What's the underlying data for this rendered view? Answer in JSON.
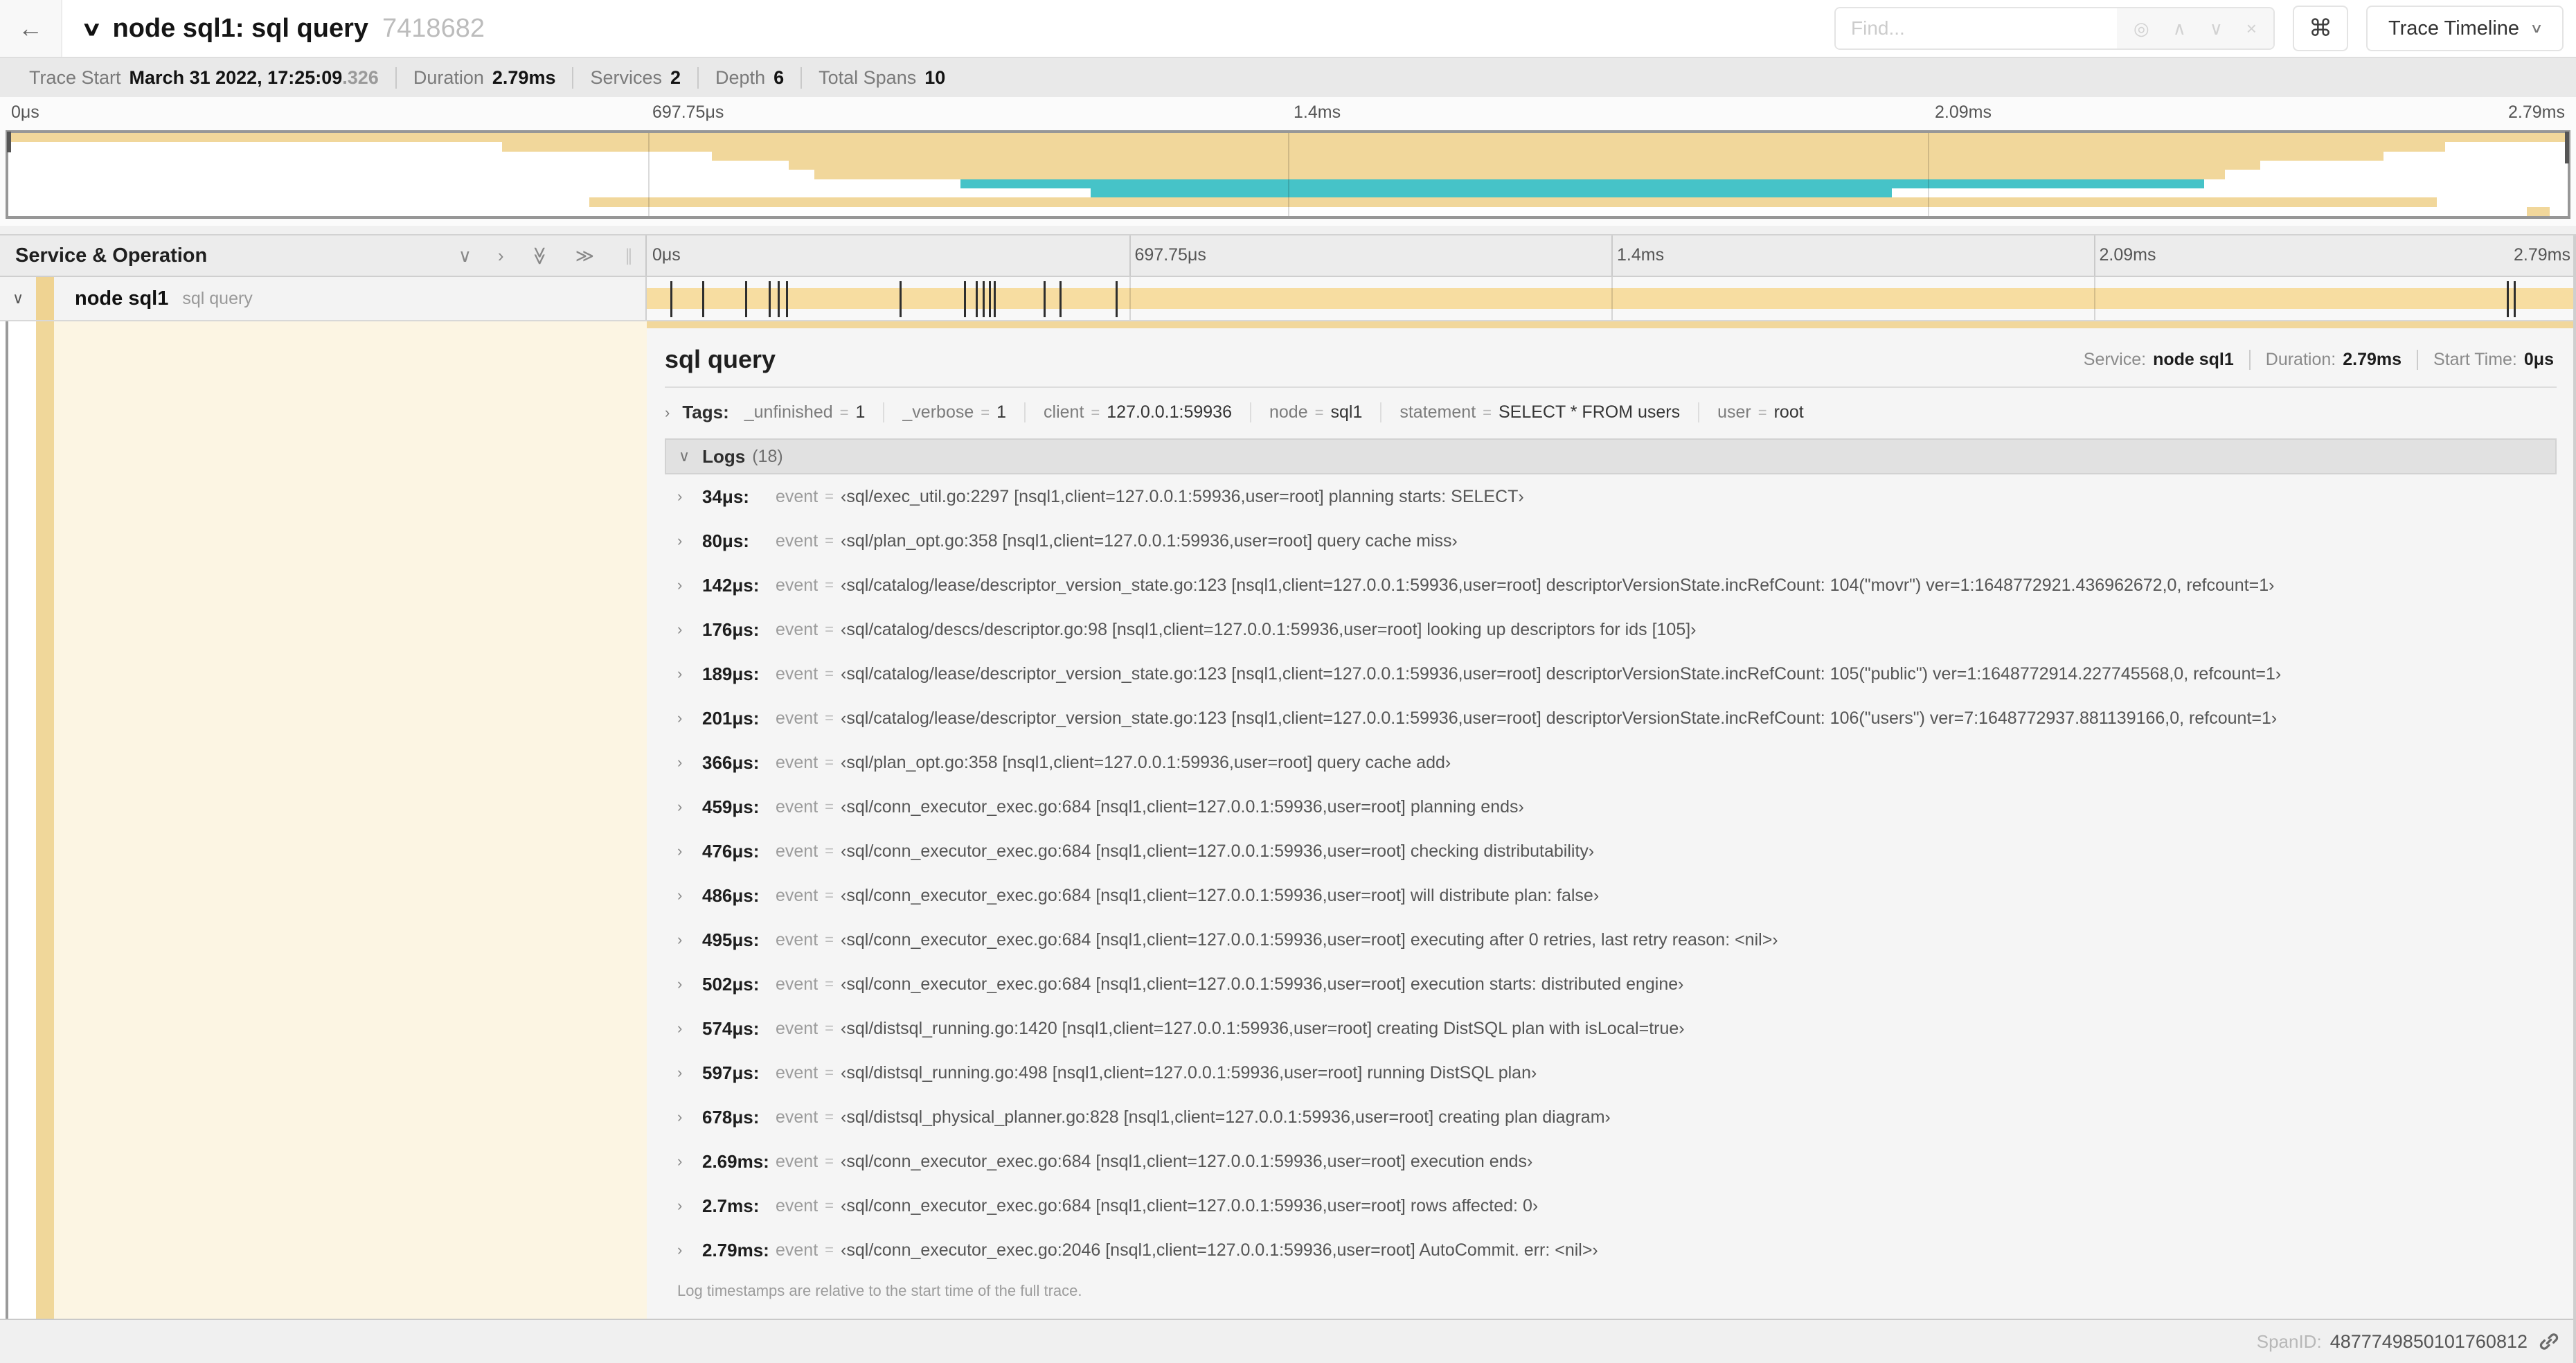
{
  "icons": {
    "back": "←",
    "collapse_down": "∨",
    "chevron_right": "›",
    "double_right": "≫",
    "drag_handle": "∥",
    "caret_down": "∨",
    "find_target": "◎",
    "find_up": "∧",
    "find_down": "∨",
    "find_close": "×",
    "command": "⌘"
  },
  "misc": {
    "eq": "="
  },
  "header": {
    "title": "node sql1: sql query",
    "trace_id": "7418682",
    "find_placeholder": "Find...",
    "view_selector": "Trace Timeline"
  },
  "summary": {
    "items": [
      {
        "label": "Trace Start",
        "value": "March 31 2022, 17:25:09",
        "suffix": ".326"
      },
      {
        "label": "Duration",
        "value": "2.79ms",
        "suffix": ""
      },
      {
        "label": "Services",
        "value": "2",
        "suffix": ""
      },
      {
        "label": "Depth",
        "value": "6",
        "suffix": ""
      },
      {
        "label": "Total Spans",
        "value": "10",
        "suffix": ""
      }
    ]
  },
  "timeline": {
    "tick_labels": [
      "0μs",
      "697.75μs",
      "1.4ms",
      "2.09ms",
      "2.79ms"
    ],
    "tick_positions": [
      0,
      25,
      50,
      75,
      100
    ]
  },
  "left_panel": {
    "header_title": "Service & Operation",
    "row": {
      "service": "node sql1",
      "operation": "sql query"
    }
  },
  "chart_data": {
    "type": "gantt-minimap",
    "total_us": 2790,
    "span_colors": {
      "sql": "#f1d79b",
      "flow": "#46c3c8"
    },
    "spans": [
      {
        "color": "#f1d79b",
        "start_frac": 0.0,
        "end_frac": 1.0
      },
      {
        "color": "#f1d79b",
        "start_frac": 0.193,
        "end_frac": 0.952
      },
      {
        "color": "#f1d79b",
        "start_frac": 0.275,
        "end_frac": 0.928
      },
      {
        "color": "#f1d79b",
        "start_frac": 0.305,
        "end_frac": 0.88
      },
      {
        "color": "#f1d79b",
        "start_frac": 0.315,
        "end_frac": 0.866
      },
      {
        "color": "#46c3c8",
        "start_frac": 0.372,
        "end_frac": 0.858
      },
      {
        "color": "#46c3c8",
        "start_frac": 0.423,
        "end_frac": 0.736
      },
      {
        "color": "#f1d79b",
        "start_frac": 0.227,
        "end_frac": 0.949
      },
      {
        "color": "#f1d79b",
        "start_frac": 0.984,
        "end_frac": 0.993
      }
    ],
    "log_marks_us": [
      34,
      80,
      142,
      176,
      189,
      201,
      366,
      459,
      476,
      486,
      495,
      502,
      574,
      597,
      678,
      2690,
      2700,
      2790
    ]
  },
  "detail": {
    "title": "sql query",
    "meta": [
      {
        "label": "Service:",
        "value": "node sql1"
      },
      {
        "label": "Duration:",
        "value": "2.79ms"
      },
      {
        "label": "Start Time:",
        "value": "0μs"
      }
    ],
    "tags_label": "Tags:",
    "tags": [
      {
        "key": "_unfinished",
        "value": "1"
      },
      {
        "key": "_verbose",
        "value": "1"
      },
      {
        "key": "client",
        "value": "127.0.0.1:59936"
      },
      {
        "key": "node",
        "value": "sql1"
      },
      {
        "key": "statement",
        "value": "SELECT * FROM users"
      },
      {
        "key": "user",
        "value": "root"
      }
    ],
    "logs_label": "Logs",
    "logs_count": "(18)",
    "logs": [
      {
        "time": "34μs:",
        "key": "event",
        "value": "‹sql/exec_util.go:2297 [nsql1,client=127.0.0.1:59936,user=root] planning starts: SELECT›"
      },
      {
        "time": "80μs:",
        "key": "event",
        "value": "‹sql/plan_opt.go:358 [nsql1,client=127.0.0.1:59936,user=root] query cache miss›"
      },
      {
        "time": "142μs:",
        "key": "event",
        "value": "‹sql/catalog/lease/descriptor_version_state.go:123 [nsql1,client=127.0.0.1:59936,user=root] descriptorVersionState.incRefCount: 104(\"movr\") ver=1:1648772921.436962672,0, refcount=1›"
      },
      {
        "time": "176μs:",
        "key": "event",
        "value": "‹sql/catalog/descs/descriptor.go:98 [nsql1,client=127.0.0.1:59936,user=root] looking up descriptors for ids [105]›"
      },
      {
        "time": "189μs:",
        "key": "event",
        "value": "‹sql/catalog/lease/descriptor_version_state.go:123 [nsql1,client=127.0.0.1:59936,user=root] descriptorVersionState.incRefCount: 105(\"public\") ver=1:1648772914.227745568,0, refcount=1›"
      },
      {
        "time": "201μs:",
        "key": "event",
        "value": "‹sql/catalog/lease/descriptor_version_state.go:123 [nsql1,client=127.0.0.1:59936,user=root] descriptorVersionState.incRefCount: 106(\"users\") ver=7:1648772937.881139166,0, refcount=1›"
      },
      {
        "time": "366μs:",
        "key": "event",
        "value": "‹sql/plan_opt.go:358 [nsql1,client=127.0.0.1:59936,user=root] query cache add›"
      },
      {
        "time": "459μs:",
        "key": "event",
        "value": "‹sql/conn_executor_exec.go:684 [nsql1,client=127.0.0.1:59936,user=root] planning ends›"
      },
      {
        "time": "476μs:",
        "key": "event",
        "value": "‹sql/conn_executor_exec.go:684 [nsql1,client=127.0.0.1:59936,user=root] checking distributability›"
      },
      {
        "time": "486μs:",
        "key": "event",
        "value": "‹sql/conn_executor_exec.go:684 [nsql1,client=127.0.0.1:59936,user=root] will distribute plan: false›"
      },
      {
        "time": "495μs:",
        "key": "event",
        "value": "‹sql/conn_executor_exec.go:684 [nsql1,client=127.0.0.1:59936,user=root] executing after 0 retries, last retry reason: <nil>›"
      },
      {
        "time": "502μs:",
        "key": "event",
        "value": "‹sql/conn_executor_exec.go:684 [nsql1,client=127.0.0.1:59936,user=root] execution starts: distributed engine›"
      },
      {
        "time": "574μs:",
        "key": "event",
        "value": "‹sql/distsql_running.go:1420 [nsql1,client=127.0.0.1:59936,user=root] creating DistSQL plan with isLocal=true›"
      },
      {
        "time": "597μs:",
        "key": "event",
        "value": "‹sql/distsql_running.go:498 [nsql1,client=127.0.0.1:59936,user=root] running DistSQL plan›"
      },
      {
        "time": "678μs:",
        "key": "event",
        "value": "‹sql/distsql_physical_planner.go:828 [nsql1,client=127.0.0.1:59936,user=root] creating plan diagram›"
      },
      {
        "time": "2.69ms:",
        "key": "event",
        "value": "‹sql/conn_executor_exec.go:684 [nsql1,client=127.0.0.1:59936,user=root] execution ends›"
      },
      {
        "time": "2.7ms:",
        "key": "event",
        "value": "‹sql/conn_executor_exec.go:684 [nsql1,client=127.0.0.1:59936,user=root] rows affected: 0›"
      },
      {
        "time": "2.79ms:",
        "key": "event",
        "value": "‹sql/conn_executor_exec.go:2046 [nsql1,client=127.0.0.1:59936,user=root] AutoCommit. err: <nil>›"
      }
    ],
    "footer_note": "Log timestamps are relative to the start time of the full trace."
  },
  "footer": {
    "spanid_label": "SpanID:",
    "spanid": "4877749850101760812"
  }
}
